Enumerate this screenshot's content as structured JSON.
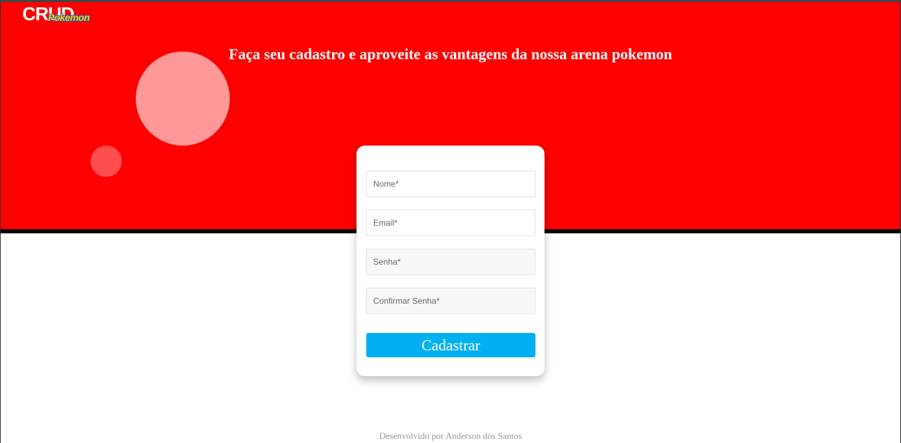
{
  "header": {
    "logo_text": "CRUD",
    "logo_sub": "Pokemon",
    "headline": "Faça seu cadastro e aproveite as vantagens da nossa arena pokemon"
  },
  "form": {
    "name_placeholder": "Nome*",
    "email_placeholder": "Email*",
    "password_placeholder": "Senha*",
    "confirm_placeholder": "Confirmar Senha*",
    "submit_label": "Cadastrar"
  },
  "footer": {
    "credit": "Desenvolvido por Anderson dos Santos"
  },
  "colors": {
    "hero": "#ff0000",
    "button": "#00b0f0"
  }
}
